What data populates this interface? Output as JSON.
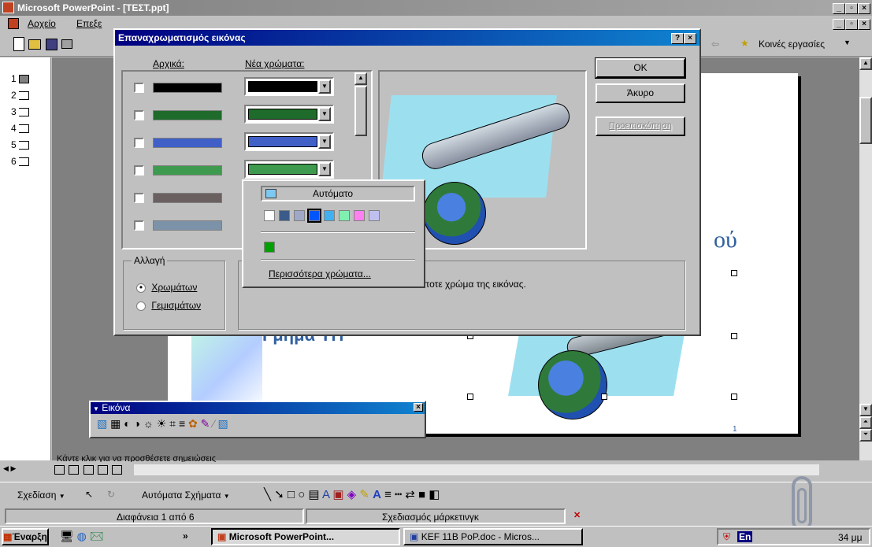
{
  "app": {
    "title": "Microsoft PowerPoint - [ΤΕΣΤ.ppt]",
    "menu": {
      "file": "Αρχείο",
      "edit": "Επεξε"
    },
    "common_tasks": "Κοινές εργασίες"
  },
  "dialog": {
    "title": "Επαναχρωματισμός εικόνας",
    "help": "?",
    "close": "×",
    "col_original": "Αρχικά:",
    "col_new": "Νέα χρώματα:",
    "ok": "OK",
    "cancel": "Άκυρο",
    "preview": "Προεπισκόπηση",
    "change_group": "Αλλαγή",
    "radio_colors": "Χρωμάτων",
    "radio_fills": "Γεμισμάτων",
    "description": "ποτε χρώμα της εικόνας.",
    "rows": [
      {
        "color": "#000000"
      },
      {
        "color": "#1f6b2b"
      },
      {
        "color": "#4060c8"
      },
      {
        "color": "#3e9a4e"
      },
      {
        "color": "#6b6060"
      },
      {
        "color": "#7c92a8"
      }
    ]
  },
  "color_dropdown": {
    "automatic": "Αυτόματο",
    "more_colors": "Περισσότερα χρώματα...",
    "palette": [
      "#ffffff",
      "#3b5b8a",
      "#a0a8c8",
      "#0055ff",
      "#40b0f0",
      "#80f0b0",
      "#ff80f0",
      "#c0c0f0"
    ],
    "recent": [
      "#00a000"
    ]
  },
  "slide": {
    "title_fragment": "ού",
    "subtitle_fragment": "Γμήμα ΥΠ",
    "page_number": "1"
  },
  "picture_toolbar": {
    "title": "Εικόνα"
  },
  "notes_placeholder": "Κάντε κλικ για να προσθέσετε σημειώσεις",
  "outline_numbers": [
    "1",
    "2",
    "3",
    "4",
    "5",
    "6"
  ],
  "drawing_toolbar": {
    "draw": "Σχεδίαση",
    "autoshapes": "Αυτόματα Σχήματα"
  },
  "status_bar": {
    "slide": "Διαφάνεια 1 από 6",
    "design": "Σχεδιασμός μάρκετινγκ"
  },
  "taskbar": {
    "start": "Έναρξη",
    "more": "»",
    "task_powerpoint": "Microsoft PowerPoint...",
    "task_word": "KEF 11B PoP.doc - Micros...",
    "lang": "En",
    "clock": "34 μμ"
  },
  "colors": {
    "title_active": "#000080",
    "slide_text": "#3060a0"
  }
}
